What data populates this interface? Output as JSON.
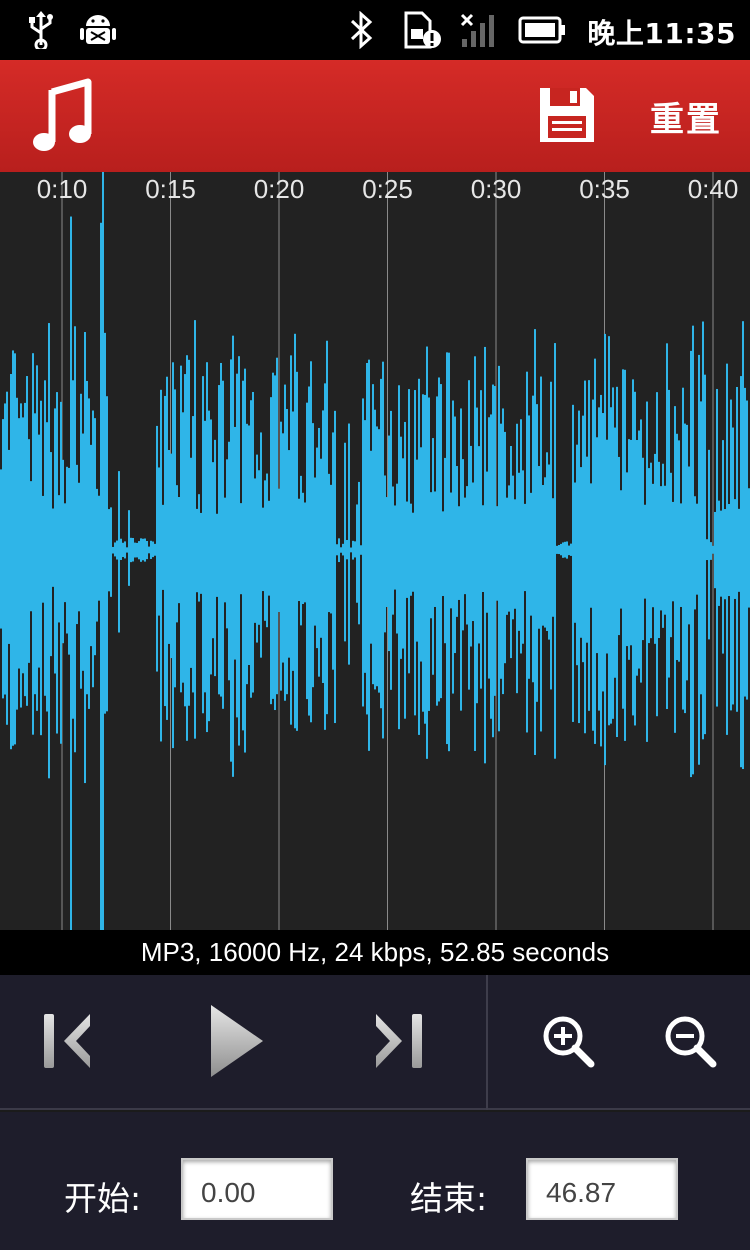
{
  "status_bar": {
    "time": "晚上11:35",
    "icons": [
      "usb-icon",
      "android-debug-icon",
      "bluetooth-icon",
      "sim-alert-icon",
      "no-signal-icon",
      "battery-icon"
    ]
  },
  "action_bar": {
    "app_icon": "music-note-icon",
    "save_icon": "save-icon",
    "reset_label": "重置",
    "accent_color": "#c9231f"
  },
  "waveform": {
    "timeline_labels": [
      "0:10",
      "0:15",
      "0:20",
      "0:25",
      "0:30",
      "0:35",
      "0:40"
    ],
    "wave_color": "#2fb5e8"
  },
  "info": {
    "text": "MP3, 16000 Hz, 24 kbps, 52.85 seconds"
  },
  "transport": {
    "icons": [
      "skip-to-start-icon",
      "play-icon",
      "skip-to-end-icon",
      "zoom-in-icon",
      "zoom-out-icon"
    ]
  },
  "trim": {
    "start_label": "开始:",
    "start_value": "0.00",
    "end_label": "结束:",
    "end_value": "46.87"
  }
}
